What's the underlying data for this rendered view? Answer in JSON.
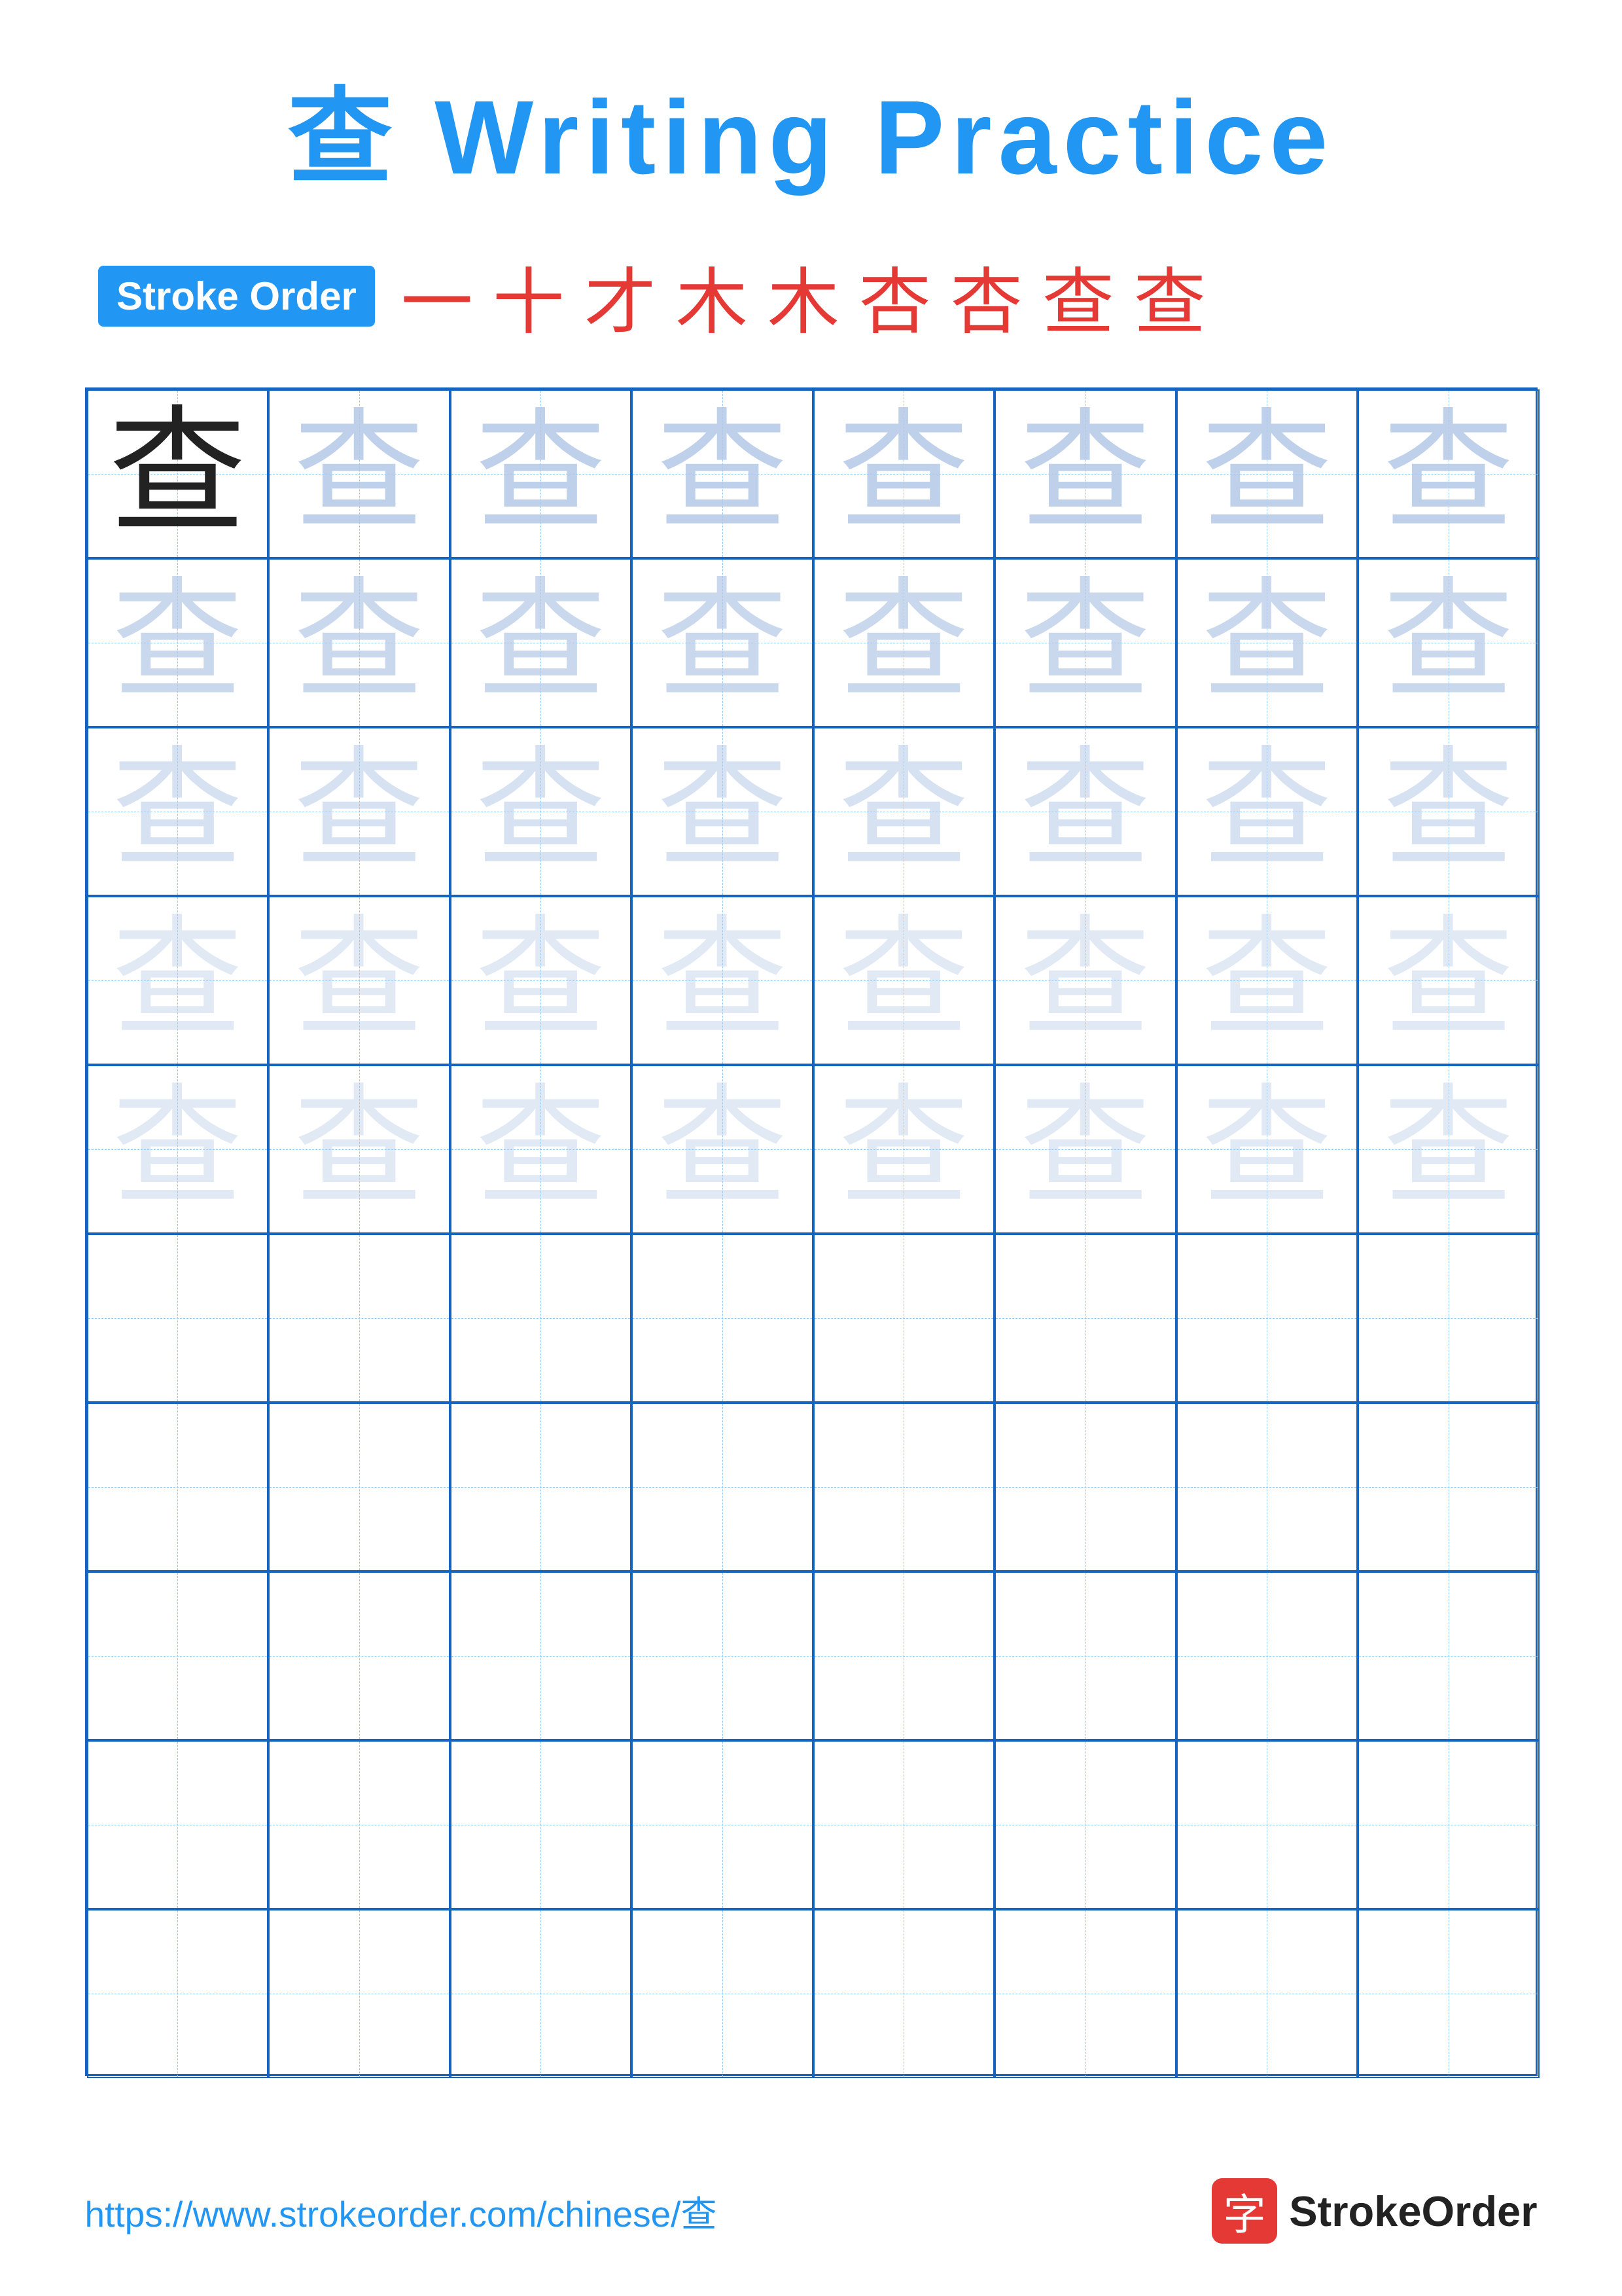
{
  "title": {
    "chinese": "查",
    "english": "Writing Practice"
  },
  "stroke_order": {
    "badge_label": "Stroke Order",
    "strokes": [
      "一",
      "十",
      "才",
      "木",
      "木",
      "杏",
      "杏",
      "查",
      "查"
    ]
  },
  "grid": {
    "rows": 10,
    "cols": 8,
    "character": "查",
    "filled_rows": 5
  },
  "footer": {
    "url": "https://www.strokeorder.com/chinese/查",
    "brand_name": "StrokeOrder",
    "brand_char": "字"
  }
}
